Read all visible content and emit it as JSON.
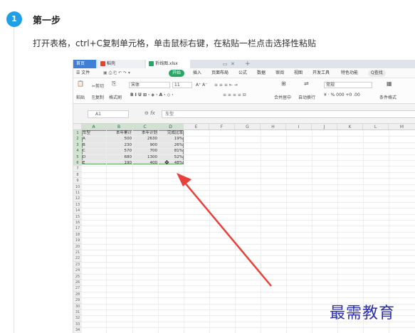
{
  "step": {
    "number": "1",
    "title": "第一步",
    "description": "打开表格，ctrl+C复制单元格，单击鼠标右键，在粘贴一栏点击选择性粘贴"
  },
  "tabs": [
    {
      "label": "首页"
    },
    {
      "label": "稻壳"
    },
    {
      "label": "折线图.xlsx"
    }
  ],
  "tab_controls": {
    "monitor": "▭",
    "close": "✕",
    "add": "+"
  },
  "menu": {
    "file": "☰ 文件",
    "items": [
      "开始",
      "插入",
      "页面布局",
      "公式",
      "数据",
      "审阅",
      "视图",
      "开发工具",
      "特色功能"
    ],
    "search": "Q查找"
  },
  "ribbon": {
    "cut": "剪切",
    "paste": "粘贴",
    "copy": "复制",
    "format_painter": "格式刷",
    "font": "宋体",
    "font_size": "11",
    "merge_center": "合并居中",
    "wrap_text": "自动换行",
    "number_format": "常规",
    "currency": "¥ · % 000 +0 .00",
    "conditional_format": "条件格式"
  },
  "formula": {
    "name_box": "A1",
    "fx": "fx",
    "content": "车型"
  },
  "columns": [
    "A",
    "B",
    "C",
    "D",
    "E",
    "F",
    "G",
    "H",
    "I",
    "J",
    "K",
    "L",
    "M"
  ],
  "rows": [
    "1",
    "2",
    "3",
    "4",
    "5",
    "6",
    "7",
    "8",
    "9",
    "10",
    "11",
    "12",
    "13",
    "14",
    "15",
    "16",
    "17",
    "18",
    "19",
    "20",
    "21",
    "22",
    "23",
    "24",
    "25",
    "26",
    "27",
    "28",
    "29",
    "30",
    "31",
    "32",
    "33",
    "34"
  ],
  "table": {
    "headers": [
      "车型",
      "本年累计",
      "本年计划",
      "完成比率"
    ],
    "rows": [
      [
        "A",
        "500",
        "2630",
        "19%"
      ],
      [
        "B",
        "230",
        "900",
        "26%"
      ],
      [
        "C",
        "570",
        "700",
        "81%"
      ],
      [
        "D",
        "680",
        "1300",
        "52%"
      ],
      [
        "E",
        "190",
        "400",
        "48%"
      ]
    ]
  },
  "watermark": "最需教育",
  "colors": {
    "accent": "#1e9fe6",
    "wps_green": "#27a567",
    "arrow": "#e8413c",
    "watermark": "#2b2faa"
  }
}
